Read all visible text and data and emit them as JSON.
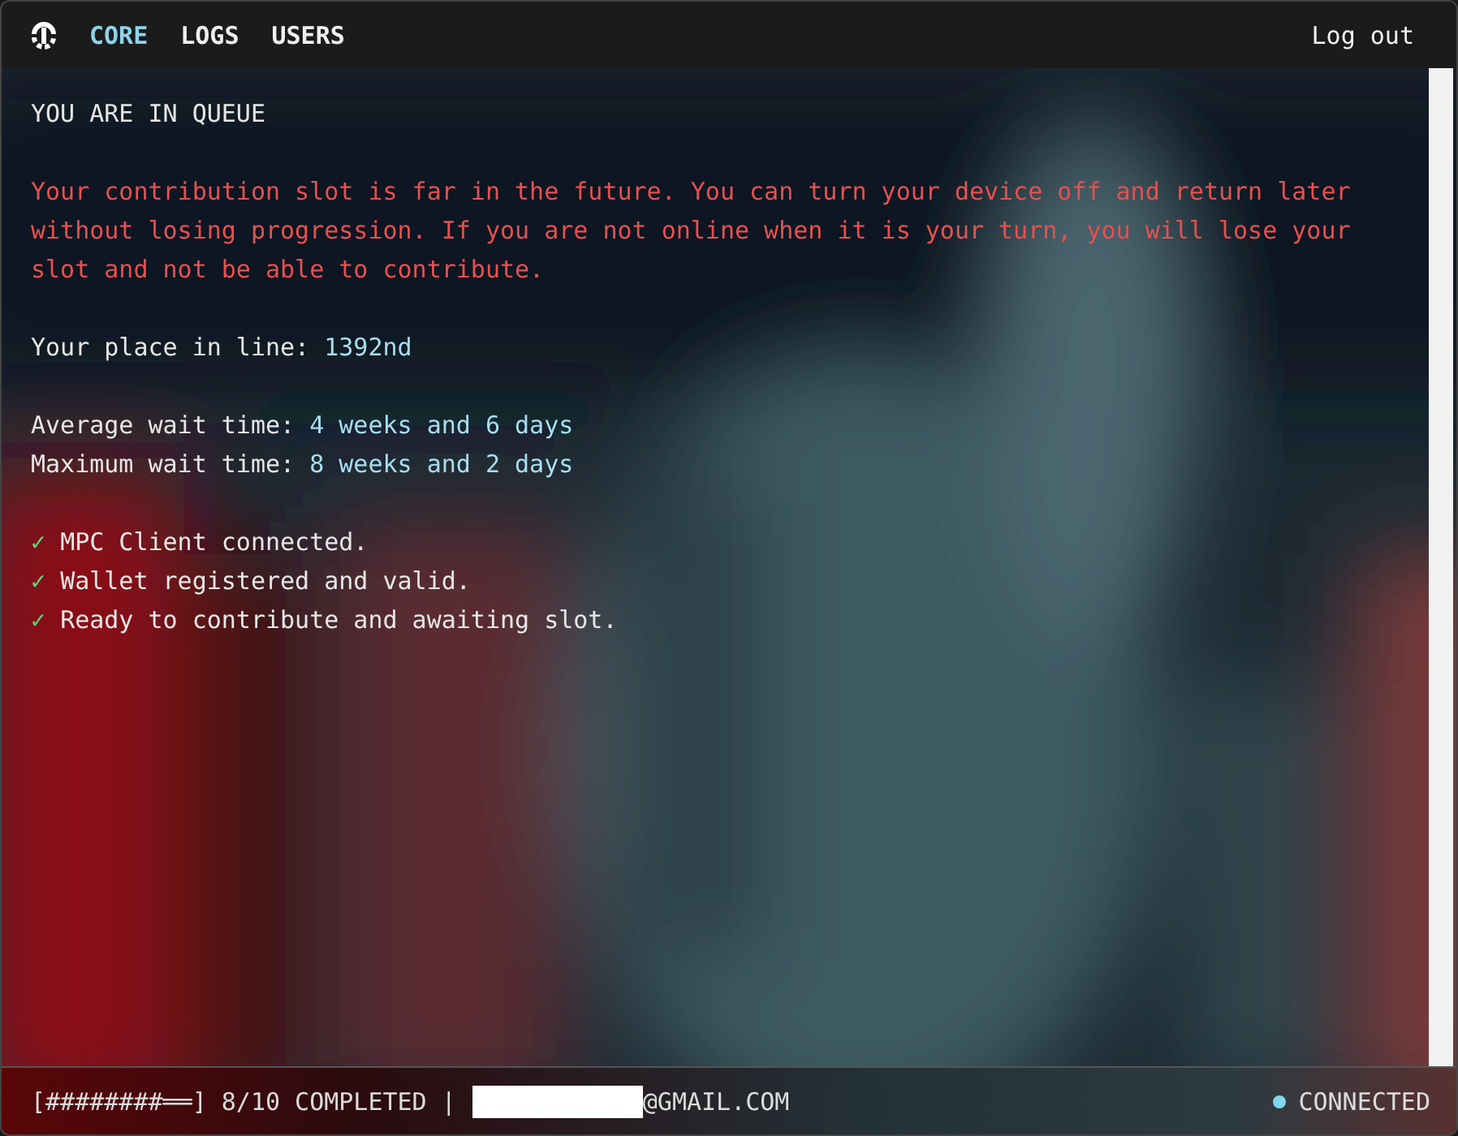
{
  "nav": {
    "tabs": [
      {
        "label": "CORE",
        "selected": true
      },
      {
        "label": "LOGS",
        "selected": false
      },
      {
        "label": "USERS",
        "selected": false
      }
    ],
    "logout": "Log out"
  },
  "heading": "YOU ARE IN QUEUE",
  "warning": "Your contribution slot is far in the future. You can turn your device off and return later without losing progression. If you are not online when it is your turn, you will lose your slot and not be able to contribute.",
  "place": {
    "label": "Your place in line:",
    "value": "1392nd"
  },
  "waits": [
    {
      "label": "Average wait time:",
      "value": "4 weeks and 6 days"
    },
    {
      "label": "Maximum wait time:",
      "value": "8 weeks and 2 days"
    }
  ],
  "checks": [
    {
      "mark": "✓",
      "text": "MPC Client connected."
    },
    {
      "mark": "✓",
      "text": "Wallet registered and valid."
    },
    {
      "mark": "✓",
      "text": "Ready to contribute and awaiting slot."
    }
  ],
  "footer": {
    "progress": "[########══] 8/10 COMPLETED |",
    "email": "@GMAIL.COM",
    "status": {
      "text": "CONNECTED",
      "color": "#7fd8f0"
    }
  }
}
